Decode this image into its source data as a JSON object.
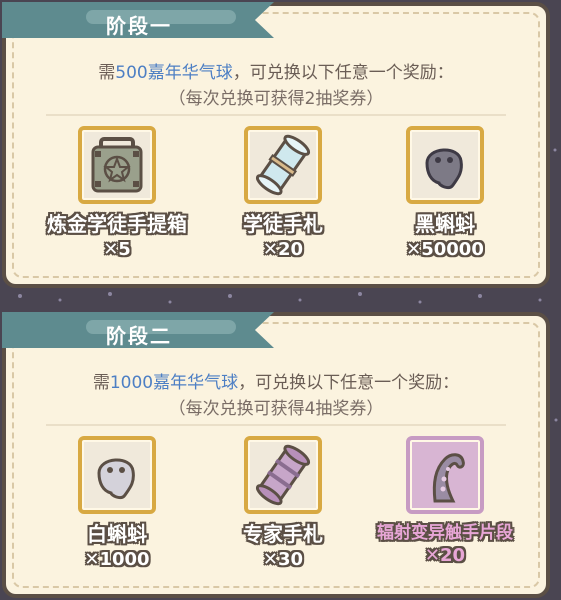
{
  "stages": [
    {
      "title": "阶段一",
      "req_prefix": "需",
      "req_item": "500嘉年华气球",
      "req_suffix": "，可兑换以下任意一个奖励：",
      "sub": "（每次兑换可获得2抽奖券）",
      "rewards": [
        {
          "icon": "alchemist-toolbox-icon",
          "name": "炼金学徒手提箱",
          "qty": "✕5"
        },
        {
          "icon": "scroll-icon",
          "name": "学徒手札",
          "qty": "✕20"
        },
        {
          "icon": "black-tadpole-icon",
          "name": "黑蝌蚪",
          "qty": "✕50000"
        }
      ]
    },
    {
      "title": "阶段二",
      "req_prefix": "需",
      "req_item": "1000嘉年华气球",
      "req_suffix": "，可兑换以下任意一个奖励：",
      "sub": "（每次兑换可获得4抽奖券）",
      "rewards": [
        {
          "icon": "white-tadpole-icon",
          "name": "白蝌蚪",
          "qty": "✕1000"
        },
        {
          "icon": "expert-scroll-icon",
          "name": "专家手札",
          "qty": "✕30"
        },
        {
          "icon": "tentacle-fragment-icon",
          "name": "辐射变异触手片段",
          "qty": "✕20"
        }
      ]
    }
  ],
  "colors": {
    "highlight": "#4d7fc4",
    "banner": "#5e8b8f",
    "frame_gold": "#d8a942",
    "special_pink": "#e7a6d6"
  }
}
